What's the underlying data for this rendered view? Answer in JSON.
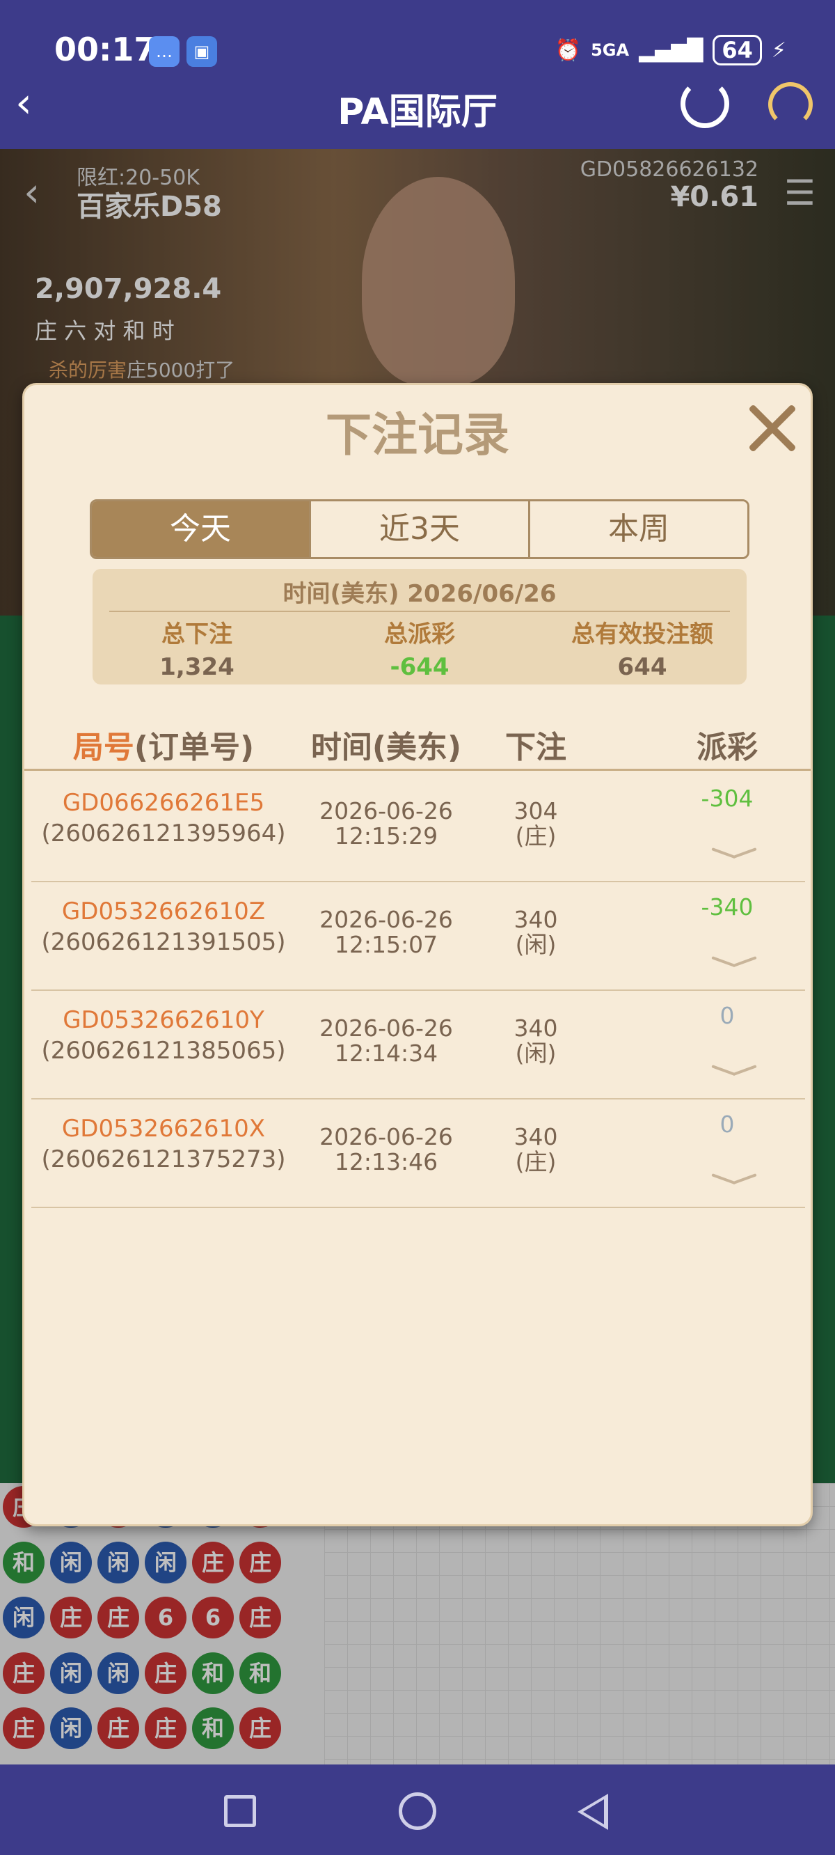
{
  "status_bar": {
    "time": "00:17",
    "network": "5GA",
    "battery": "64"
  },
  "header": {
    "title": "PA国际厅",
    "back_icon": "chevron-left-icon",
    "refresh_icon": "refresh-icon",
    "support_icon": "headset-icon"
  },
  "game": {
    "limit": "限红:20-50K",
    "table_name": "百家乐D58",
    "game_code": "GD05826626132",
    "balance": "¥0.61",
    "pool": "2,907,928.4",
    "bet_types": "庄 六 对 和 时",
    "chat_name": "杀的厉害",
    "chat_text": "庄5000打了",
    "beads": [
      [
        "庄",
        "闲",
        "庄",
        "闲",
        "闲",
        "庄"
      ],
      [
        "和",
        "闲",
        "闲",
        "闲",
        "庄",
        "庄"
      ],
      [
        "闲",
        "庄",
        "庄",
        "6",
        "6",
        "庄"
      ],
      [
        "庄",
        "闲",
        "闲",
        "庄",
        "和",
        "和"
      ],
      [
        "庄",
        "闲",
        "庄",
        "庄",
        "和",
        "庄"
      ]
    ]
  },
  "modal": {
    "title": "下注记录",
    "tabs": [
      {
        "label": "今天",
        "active": true
      },
      {
        "label": "近3天",
        "active": false
      },
      {
        "label": "本周",
        "active": false
      }
    ],
    "summary": {
      "date_line": "时间(美东) 2026/06/26",
      "total_bet_label": "总下注",
      "total_bet": "1,324",
      "total_payout_label": "总派彩",
      "total_payout": "-644",
      "total_valid_label": "总有效投注额",
      "total_valid": "644"
    },
    "columns": {
      "id_prefix": "局号",
      "id_suffix": "(订单号)",
      "time": "时间(美东)",
      "bet": "下注",
      "payout": "派彩"
    },
    "rows": [
      {
        "game_id": "GD066266261E5",
        "order": "(260626121395964)",
        "date": "2026-06-26",
        "time": "12:15:29",
        "bet": "304",
        "side": "(庄)",
        "payout": "-304"
      },
      {
        "game_id": "GD0532662610Z",
        "order": "(260626121391505)",
        "date": "2026-06-26",
        "time": "12:15:07",
        "bet": "340",
        "side": "(闲)",
        "payout": "-340"
      },
      {
        "game_id": "GD0532662610Y",
        "order": "(260626121385065)",
        "date": "2026-06-26",
        "time": "12:14:34",
        "bet": "340",
        "side": "(闲)",
        "payout": "0"
      },
      {
        "game_id": "GD0532662610X",
        "order": "(260626121375273)",
        "date": "2026-06-26",
        "time": "12:13:46",
        "bet": "340",
        "side": "(庄)",
        "payout": "0"
      }
    ]
  },
  "colors": {
    "header_bg": "#3d3b8a",
    "modal_bg": "#f7ebd8",
    "accent_orange": "#e07838",
    "negative_green": "#5fbf3f"
  }
}
